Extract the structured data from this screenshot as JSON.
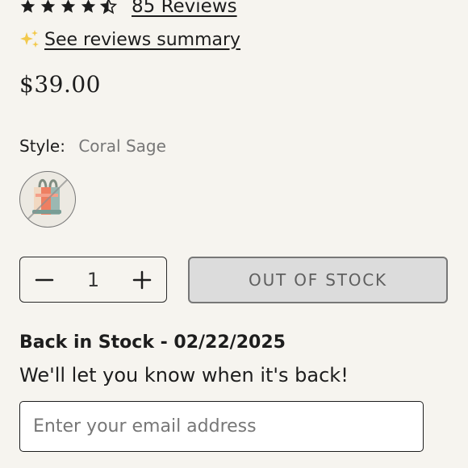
{
  "rating": {
    "stars": 4.5,
    "review_link": "85 Reviews"
  },
  "summary": {
    "icon": "sparkle-icon",
    "label": "See reviews summary"
  },
  "price": "$39.00",
  "style": {
    "label": "Style:",
    "value": "Coral Sage"
  },
  "swatch": {
    "icon": "coral-sage-bag-thumbnail"
  },
  "quantity": {
    "value": "1",
    "minus_icon": "minus-icon",
    "plus_icon": "plus-icon"
  },
  "stock_button": {
    "label": "OUT OF STOCK"
  },
  "back_in_stock": {
    "title": "Back in Stock - 02/22/2025",
    "subtitle": "We'll let you know when it's back!",
    "email_placeholder": "Enter your email address"
  },
  "colors": {
    "background": "#f6f4ef",
    "text": "#1d1d1d",
    "sparkle": "#f2c94c",
    "disabled_button": "#dcdcdc"
  }
}
